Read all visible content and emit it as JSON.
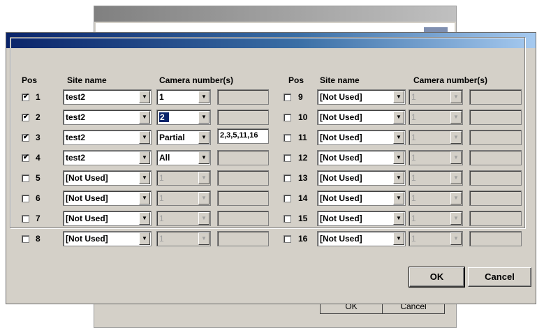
{
  "background_window": {
    "ok_label": "OK",
    "cancel_label": "Cancel"
  },
  "headers": {
    "pos": "Pos",
    "site_name": "Site name",
    "camera_numbers": "Camera number(s)"
  },
  "rows": [
    {
      "pos": "1",
      "checked": true,
      "site": "test2",
      "camera": "1",
      "extra": "",
      "disabled": false,
      "selected": false
    },
    {
      "pos": "2",
      "checked": true,
      "site": "test2",
      "camera": "2",
      "extra": "",
      "disabled": false,
      "selected": true
    },
    {
      "pos": "3",
      "checked": true,
      "site": "test2",
      "camera": "Partial",
      "extra": "2,3,5,11,16",
      "disabled": false,
      "selected": false
    },
    {
      "pos": "4",
      "checked": true,
      "site": "test2",
      "camera": "All",
      "extra": "",
      "disabled": false,
      "selected": false
    },
    {
      "pos": "5",
      "checked": false,
      "site": "[Not Used]",
      "camera": "1",
      "extra": "",
      "disabled": true,
      "selected": false
    },
    {
      "pos": "6",
      "checked": false,
      "site": "[Not Used]",
      "camera": "1",
      "extra": "",
      "disabled": true,
      "selected": false
    },
    {
      "pos": "7",
      "checked": false,
      "site": "[Not Used]",
      "camera": "1",
      "extra": "",
      "disabled": true,
      "selected": false
    },
    {
      "pos": "8",
      "checked": false,
      "site": "[Not Used]",
      "camera": "1",
      "extra": "",
      "disabled": true,
      "selected": false
    },
    {
      "pos": "9",
      "checked": false,
      "site": "[Not Used]",
      "camera": "1",
      "extra": "",
      "disabled": true,
      "selected": false
    },
    {
      "pos": "10",
      "checked": false,
      "site": "[Not Used]",
      "camera": "1",
      "extra": "",
      "disabled": true,
      "selected": false
    },
    {
      "pos": "11",
      "checked": false,
      "site": "[Not Used]",
      "camera": "1",
      "extra": "",
      "disabled": true,
      "selected": false
    },
    {
      "pos": "12",
      "checked": false,
      "site": "[Not Used]",
      "camera": "1",
      "extra": "",
      "disabled": true,
      "selected": false
    },
    {
      "pos": "13",
      "checked": false,
      "site": "[Not Used]",
      "camera": "1",
      "extra": "",
      "disabled": true,
      "selected": false
    },
    {
      "pos": "14",
      "checked": false,
      "site": "[Not Used]",
      "camera": "1",
      "extra": "",
      "disabled": true,
      "selected": false
    },
    {
      "pos": "15",
      "checked": false,
      "site": "[Not Used]",
      "camera": "1",
      "extra": "",
      "disabled": true,
      "selected": false
    },
    {
      "pos": "16",
      "checked": false,
      "site": "[Not Used]",
      "camera": "1",
      "extra": "",
      "disabled": true,
      "selected": false
    }
  ],
  "icons": {
    "dropdown": "chevron-down-icon",
    "check": "checkmark-icon"
  },
  "buttons": {
    "ok_label": "OK",
    "cancel_label": "Cancel"
  },
  "colors": {
    "titlebar_start": "#0a246a",
    "titlebar_end": "#a6caf0",
    "dialog_bg": "#d4d0c8",
    "selection": "#0a246a"
  }
}
